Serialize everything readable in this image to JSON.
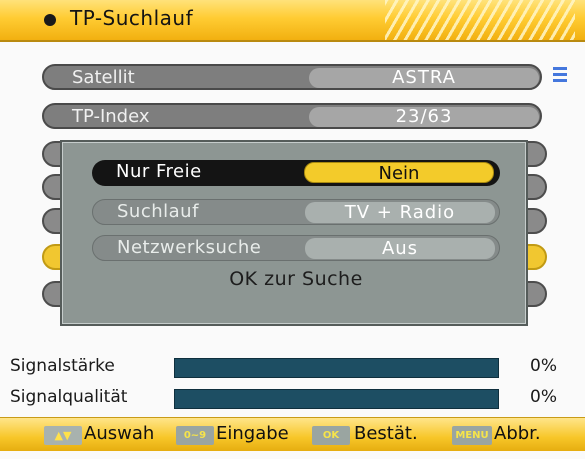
{
  "title": "TP-Suchlauf",
  "menu": [
    {
      "label": "Satellit",
      "value": "ASTRA"
    },
    {
      "label": "TP-Index",
      "value": "23/63"
    }
  ],
  "dialog": {
    "rows": [
      {
        "label": "Nur Freie",
        "value": "Nein"
      },
      {
        "label": "Suchlauf",
        "value": "TV + Radio"
      },
      {
        "label": "Netzwerksuche",
        "value": "Aus"
      }
    ],
    "ok_text": "OK zur Suche"
  },
  "signal": {
    "strength_label": "Signalstärke",
    "strength_value": "0%",
    "quality_label": "Signalqualität",
    "quality_value": "0%"
  },
  "footer": {
    "key_arrows": "▲▼",
    "label_select": "Auswah",
    "key_digits": "0~9",
    "label_input": "Eingabe",
    "key_ok": "OK",
    "label_confirm": "Bestät.",
    "key_menu": "MENU",
    "label_cancel": "Abbr."
  },
  "colors": {
    "accent_yellow": "#f3cb2a",
    "bar_fill": "#1d4e63",
    "dialog_bg": "#8d9693"
  }
}
